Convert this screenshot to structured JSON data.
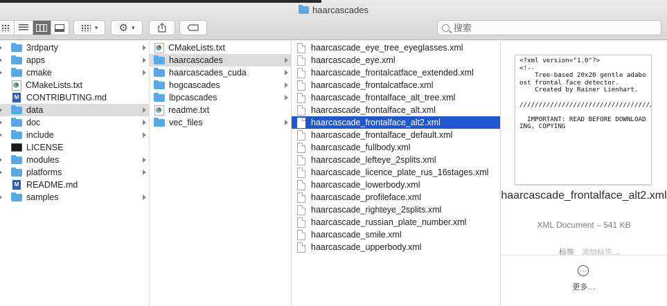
{
  "window": {
    "title": "haarcascades"
  },
  "toolbar": {
    "view_modes": [
      "icons",
      "list",
      "columns",
      "gallery"
    ],
    "active_view": "columns",
    "search_placeholder": "搜索"
  },
  "column1": [
    {
      "name": "3rdparty",
      "type": "folder",
      "chevron": true
    },
    {
      "name": "apps",
      "type": "folder",
      "chevron": true
    },
    {
      "name": "cmake",
      "type": "folder",
      "chevron": true
    },
    {
      "name": "CMakeLists.txt",
      "type": "cmake",
      "chevron": false
    },
    {
      "name": "CONTRIBUTING.md",
      "type": "md",
      "chevron": false
    },
    {
      "name": "data",
      "type": "folder",
      "chevron": true,
      "selected": true
    },
    {
      "name": "doc",
      "type": "folder",
      "chevron": true
    },
    {
      "name": "include",
      "type": "folder",
      "chevron": true
    },
    {
      "name": "LICENSE",
      "type": "terminal",
      "chevron": false
    },
    {
      "name": "modules",
      "type": "folder",
      "chevron": true
    },
    {
      "name": "platforms",
      "type": "folder",
      "chevron": true
    },
    {
      "name": "README.md",
      "type": "md",
      "chevron": false
    },
    {
      "name": "samples",
      "type": "folder",
      "chevron": true
    }
  ],
  "column2": [
    {
      "name": "CMakeLists.txt",
      "type": "cmake",
      "chevron": false
    },
    {
      "name": "haarcascades",
      "type": "folder",
      "chevron": true,
      "selected": true
    },
    {
      "name": "haarcascades_cuda",
      "type": "folder",
      "chevron": true
    },
    {
      "name": "hogcascades",
      "type": "folder",
      "chevron": true
    },
    {
      "name": "lbpcascades",
      "type": "folder",
      "chevron": true
    },
    {
      "name": "readme.txt",
      "type": "cmake",
      "chevron": false
    },
    {
      "name": "vec_files",
      "type": "folder",
      "chevron": true
    }
  ],
  "column3": [
    {
      "name": "haarcascade_eye_tree_eyeglasses.xml"
    },
    {
      "name": "haarcascade_eye.xml"
    },
    {
      "name": "haarcascade_frontalcatface_extended.xml"
    },
    {
      "name": "haarcascade_frontalcatface.xml"
    },
    {
      "name": "haarcascade_frontalface_alt_tree.xml"
    },
    {
      "name": "haarcascade_frontalface_alt.xml"
    },
    {
      "name": "haarcascade_frontalface_alt2.xml",
      "selected": true
    },
    {
      "name": "haarcascade_frontalface_default.xml"
    },
    {
      "name": "haarcascade_fullbody.xml"
    },
    {
      "name": "haarcascade_lefteye_2splits.xml"
    },
    {
      "name": "haarcascade_licence_plate_rus_16stages.xml"
    },
    {
      "name": "haarcascade_lowerbody.xml"
    },
    {
      "name": "haarcascade_profileface.xml"
    },
    {
      "name": "haarcascade_righteye_2splits.xml"
    },
    {
      "name": "haarcascade_russian_plate_number.xml"
    },
    {
      "name": "haarcascade_smile.xml"
    },
    {
      "name": "haarcascade_upperbody.xml"
    }
  ],
  "preview": {
    "content": "<?xml version=\"1.0\"?>\n<!--\n    Tree-based 20x20 gentle adaboost frontal face detector.\n    Created by Rainer Lienhart.\n\n//////////////////////////////////////////////////////////////////////////////////////\n\n  IMPORTANT: READ BEFORE DOWNLOADING, COPYING",
    "file_name": "haarcascade_frontalface_alt2.xml",
    "kind": "XML Document – 541 KB",
    "tags_label": "标签",
    "tags_placeholder": "添加标签…",
    "more_label": "更多…"
  }
}
